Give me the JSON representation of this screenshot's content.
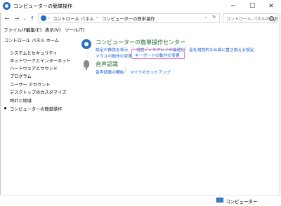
{
  "window": {
    "title": "コンピューターの簡単操作",
    "controls": {
      "minimize": "─",
      "maximize": "☐",
      "close": "✕"
    }
  },
  "nav": {
    "back": "←",
    "forward": "→",
    "up": "↑",
    "breadcrumb": [
      "コントロール パネル",
      "コンピューターの簡単操作"
    ],
    "separator": "›",
    "dropdown": "⌄",
    "refresh": "↻",
    "search_placeholder": "コントロール パネルの検索"
  },
  "menubar": [
    "ファイル(F)",
    "編集(E)",
    "表示(V)",
    "ツール(T)"
  ],
  "sidebar": {
    "home": "コントロール パネル ホーム",
    "items": [
      "システムとセキュリティ",
      "ネットワークとインターネット",
      "ハードウェアとサウンド",
      "プログラム",
      "ユーザー アカウント",
      "デスクトップのカスタマイズ",
      "時計と地域",
      "コンピューターの簡単操作"
    ],
    "current": "コンピューターの簡単操作"
  },
  "sections": [
    {
      "title": "コンピューターの簡単操作センター",
      "links_row1": [
        "設定の推奨を表示",
        "視覚ディスプレイの最適化",
        "音を視覚的な合図に置き換える設定"
      ],
      "links_row2": [
        "マウスの動作の変更",
        "キーボードの動作の変更"
      ]
    },
    {
      "title": "音声認識",
      "links": [
        "音声認識の開始",
        "マイクのセットアップ"
      ]
    }
  ],
  "statusbar": {
    "label": "コンピューター"
  },
  "colors": {
    "link": "#0b5ad7",
    "section_title": "#1e6d2c",
    "highlight": "#ee8ab8"
  }
}
